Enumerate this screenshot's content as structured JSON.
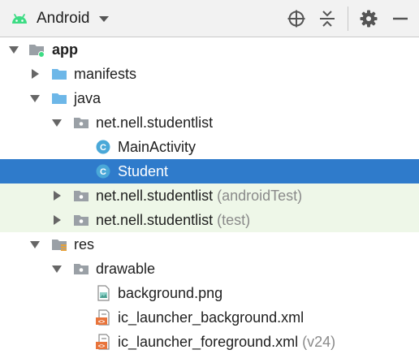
{
  "toolbar": {
    "view": "Android",
    "icons": [
      "android-icon",
      "chevron-down-icon",
      "crosshair-icon",
      "collapse-all-icon",
      "gear-icon",
      "minimize-icon"
    ]
  },
  "colors": {
    "selection": "#2f7bcb",
    "test_row": "#eef7e8",
    "folder": "#6db7e8",
    "package": "#9aa0a6",
    "class_badge": "#4aa8d8"
  },
  "tree": [
    {
      "label": "app",
      "suffix": "",
      "icon": "module-folder-icon",
      "expanded": true
    },
    {
      "label": "manifests",
      "suffix": "",
      "icon": "folder-icon",
      "expanded": false
    },
    {
      "label": "java",
      "suffix": "",
      "icon": "folder-icon",
      "expanded": true
    },
    {
      "label": "net.nell.studentlist",
      "suffix": "",
      "icon": "package-icon",
      "expanded": true
    },
    {
      "label": "MainActivity",
      "suffix": "",
      "icon": "class-icon"
    },
    {
      "label": "Student",
      "suffix": "",
      "icon": "class-icon",
      "selected": true
    },
    {
      "label": "net.nell.studentlist",
      "suffix": " (androidTest)",
      "icon": "package-icon",
      "expanded": false
    },
    {
      "label": "net.nell.studentlist",
      "suffix": " (test)",
      "icon": "package-icon",
      "expanded": false
    },
    {
      "label": "res",
      "suffix": "",
      "icon": "res-folder-icon",
      "expanded": true
    },
    {
      "label": "drawable",
      "suffix": "",
      "icon": "package-icon",
      "expanded": true
    },
    {
      "label": "background.png",
      "suffix": "",
      "icon": "image-file-icon"
    },
    {
      "label": "ic_launcher_background.xml",
      "suffix": "",
      "icon": "xml-file-icon"
    },
    {
      "label": "ic_launcher_foreground.xml",
      "suffix": " (v24)",
      "icon": "xml-file-icon"
    }
  ]
}
